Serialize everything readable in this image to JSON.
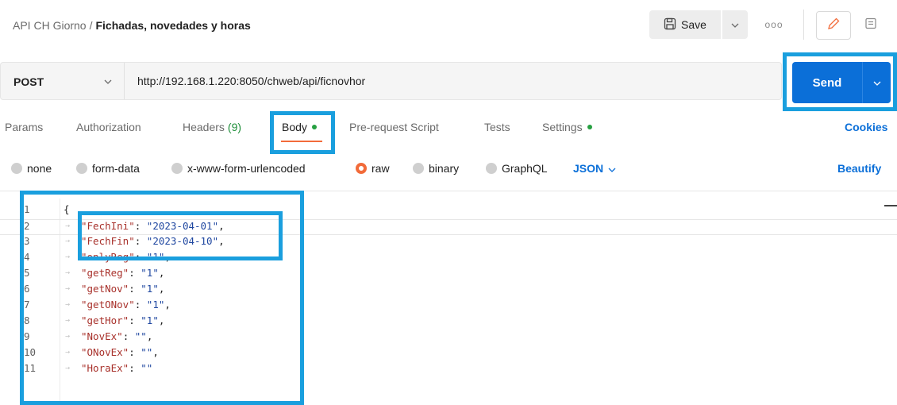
{
  "header": {
    "collection": "API CH Giorno",
    "separator": "/",
    "request_name": "Fichadas, novedades y horas",
    "save_label": "Save",
    "more_label": "ooo"
  },
  "request": {
    "method": "POST",
    "url": "http://192.168.1.220:8050/chweb/api/ficnovhor",
    "send_label": "Send"
  },
  "tabs": {
    "params": "Params",
    "authorization": "Authorization",
    "headers": "Headers",
    "headers_count": "(9)",
    "body": "Body",
    "prerequest": "Pre-request Script",
    "tests": "Tests",
    "settings": "Settings",
    "cookies": "Cookies"
  },
  "body_modes": {
    "none": "none",
    "form_data": "form-data",
    "urlencoded": "x-www-form-urlencoded",
    "raw": "raw",
    "binary": "binary",
    "graphql": "GraphQL",
    "selected": "raw",
    "format": "JSON",
    "beautify": "Beautify"
  },
  "editor": {
    "open_brace": "{",
    "lines": [
      {
        "n": "1"
      },
      {
        "n": "2",
        "key": "\"FechIni\"",
        "value": "\"2023-04-01\""
      },
      {
        "n": "3",
        "key": "\"FechFin\"",
        "value": "\"2023-04-10\""
      },
      {
        "n": "4",
        "key": "\"onlyReg\"",
        "value": "\"1\""
      },
      {
        "n": "5",
        "key": "\"getReg\"",
        "value": "\"1\""
      },
      {
        "n": "6",
        "key": "\"getNov\"",
        "value": "\"1\""
      },
      {
        "n": "7",
        "key": "\"getONov\"",
        "value": "\"1\""
      },
      {
        "n": "8",
        "key": "\"getHor\"",
        "value": "\"1\""
      },
      {
        "n": "9",
        "key": "\"NovEx\"",
        "value": "\"\""
      },
      {
        "n": "10",
        "key": "\"ONovEx\"",
        "value": "\"\""
      },
      {
        "n": "11",
        "key": "\"HoraEx\"",
        "value": "\"\""
      }
    ]
  },
  "colors": {
    "accent_blue": "#0b6fd8",
    "highlight_box": "#1a9fde",
    "active_tab": "#f26b3a",
    "status_dot": "#26a041"
  }
}
